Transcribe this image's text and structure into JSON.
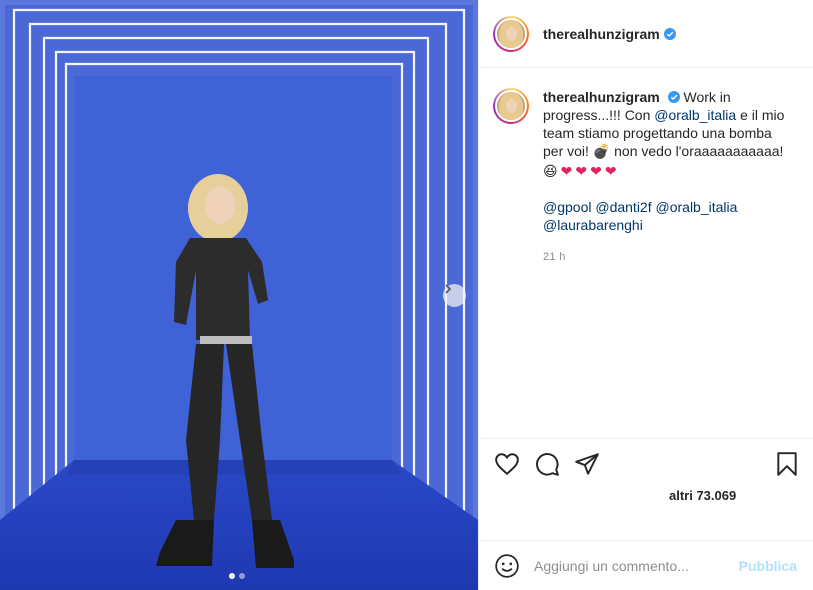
{
  "post": {
    "username": "therealhunzigram",
    "caption": {
      "username": "therealhunzigram",
      "line1_a": "Work in",
      "line2_a": "progress...!!! Con ",
      "mention1": "@oralb_italia",
      "line2_b": " e il mio",
      "line3": "team stiamo progettando una bomba",
      "line4_a": "per voi! ",
      "bomb": "💣",
      "line4_b": " non vedo l'oraaaaaaaaaaa!",
      "emoji_laugh": "😆",
      "hearts": [
        "❤",
        "❤",
        "❤",
        "❤"
      ],
      "tags": [
        "@gpool",
        "@danti2f",
        "@oralb_italia",
        "@laurabarenghi"
      ]
    },
    "time": "21 h",
    "likes_text": "altri 73.069",
    "icons": [
      "heart-icon",
      "comment-icon",
      "share-icon",
      "bookmark-icon",
      "smiley-icon",
      "chevron-right-icon",
      "verified-icon"
    ],
    "carousel_count": 2,
    "carousel_active": 1
  },
  "comment": {
    "placeholder": "Aggiungi un commento...",
    "publish_label": "Pubblica"
  },
  "colors": {
    "mention": "#00376b",
    "verified": "#3897f0",
    "publish_disabled": "#b2dffc",
    "photo_blue": "#3f5fd0"
  }
}
